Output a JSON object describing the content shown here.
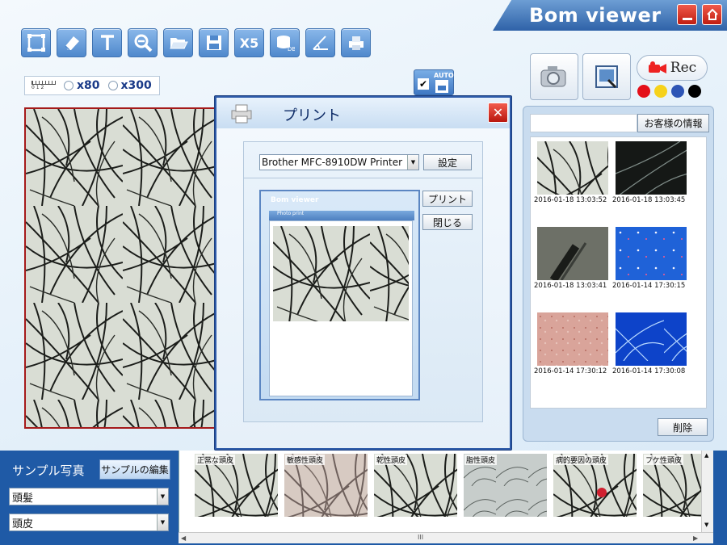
{
  "app": {
    "title": "Bom viewer"
  },
  "toolbar": [
    {
      "icon": "crop-icon"
    },
    {
      "icon": "eraser-icon"
    },
    {
      "icon": "text-icon",
      "label": ""
    },
    {
      "icon": "zoom-out-icon"
    },
    {
      "icon": "folder-open-icon"
    },
    {
      "icon": "save-icon"
    },
    {
      "icon": "x5-icon",
      "label": "X5"
    },
    {
      "icon": "database-icon",
      "label": "DB"
    },
    {
      "icon": "angle-icon"
    },
    {
      "icon": "printer-icon"
    }
  ],
  "magnification": {
    "scale_ticks": "0 1 2",
    "options": [
      "x80",
      "x300"
    ]
  },
  "auto_save": {
    "label": "AUTO",
    "checked": true
  },
  "record": {
    "label": "Rec"
  },
  "color_dots": [
    "#e4101a",
    "#f6d21b",
    "#2d55b5",
    "#000000"
  ],
  "gallery": {
    "customer_button": "お客様の情報",
    "delete_button": "削除",
    "items": [
      {
        "timestamp": "2016-01-18 13:03:52",
        "style": "hair"
      },
      {
        "timestamp": "2016-01-18 13:03:45",
        "style": "dark-hair"
      },
      {
        "timestamp": "2016-01-18 13:03:41",
        "style": "probe"
      },
      {
        "timestamp": "2016-01-14 17:30:15",
        "style": "blue-dots"
      },
      {
        "timestamp": "2016-01-14 17:30:12",
        "style": "pink-skin"
      },
      {
        "timestamp": "2016-01-14 17:30:08",
        "style": "uv-hair"
      }
    ]
  },
  "print_dialog": {
    "title": "プリント",
    "printer": "Brother MFC-8910DW Printer",
    "settings_button": "設定",
    "print_button": "プリント",
    "close_button": "閉じる",
    "preview_app_title": "Bom viewer",
    "preview_subtitle": "Photo print"
  },
  "samples": {
    "label": "サンプル写真",
    "edit_button": "サンプルの編集",
    "hair_select": "頭髪",
    "scalp_select": "頭皮",
    "items": [
      {
        "label": "正常な頭皮",
        "style": "hair"
      },
      {
        "label": "敏感性頭皮",
        "style": "pink-hair"
      },
      {
        "label": "乾性頭皮",
        "style": "hair"
      },
      {
        "label": "脂性頭皮",
        "style": "light-skin"
      },
      {
        "label": "病的要因の頭皮",
        "style": "red-spot"
      },
      {
        "label": "フケ性頭皮",
        "style": "hair"
      }
    ]
  },
  "scrollbar": {
    "grip": "III"
  }
}
